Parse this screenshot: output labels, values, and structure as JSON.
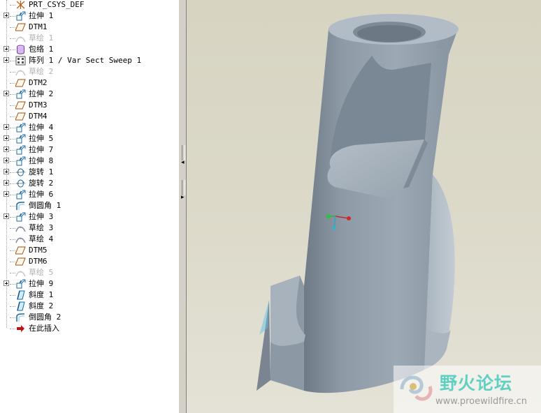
{
  "model_tree": {
    "items": [
      {
        "label": "PRT_CSYS_DEF",
        "icon": "csys-icon",
        "expandable": false,
        "suppressed": false
      },
      {
        "label": "拉伸 1",
        "icon": "extrude-icon",
        "expandable": true,
        "suppressed": false
      },
      {
        "label": "DTM1",
        "icon": "datum-plane-icon",
        "expandable": false,
        "suppressed": false
      },
      {
        "label": "草绘 1",
        "icon": "sketch-icon",
        "expandable": false,
        "suppressed": true
      },
      {
        "label": "包络 1",
        "icon": "wrap-icon",
        "expandable": true,
        "suppressed": false
      },
      {
        "label": "阵列 1 / Var Sect Sweep 1",
        "icon": "pattern-icon",
        "expandable": true,
        "suppressed": false
      },
      {
        "label": "草绘 2",
        "icon": "sketch-icon",
        "expandable": false,
        "suppressed": true
      },
      {
        "label": "DTM2",
        "icon": "datum-plane-icon",
        "expandable": false,
        "suppressed": false
      },
      {
        "label": "拉伸 2",
        "icon": "extrude-icon",
        "expandable": true,
        "suppressed": false
      },
      {
        "label": "DTM3",
        "icon": "datum-plane-icon",
        "expandable": false,
        "suppressed": false
      },
      {
        "label": "DTM4",
        "icon": "datum-plane-icon",
        "expandable": false,
        "suppressed": false
      },
      {
        "label": "拉伸 4",
        "icon": "extrude-icon",
        "expandable": true,
        "suppressed": false
      },
      {
        "label": "拉伸 5",
        "icon": "extrude-icon",
        "expandable": true,
        "suppressed": false
      },
      {
        "label": "拉伸 7",
        "icon": "extrude-icon",
        "expandable": true,
        "suppressed": false
      },
      {
        "label": "拉伸 8",
        "icon": "extrude-icon",
        "expandable": true,
        "suppressed": false
      },
      {
        "label": "旋转 1",
        "icon": "revolve-icon",
        "expandable": true,
        "suppressed": false
      },
      {
        "label": "旋转 2",
        "icon": "revolve-icon",
        "expandable": true,
        "suppressed": false
      },
      {
        "label": "拉伸 6",
        "icon": "extrude-icon",
        "expandable": true,
        "suppressed": false
      },
      {
        "label": "倒圆角 1",
        "icon": "round-icon",
        "expandable": false,
        "suppressed": false
      },
      {
        "label": "拉伸 3",
        "icon": "extrude-icon",
        "expandable": true,
        "suppressed": false
      },
      {
        "label": "草绘 3",
        "icon": "sketch-icon",
        "expandable": false,
        "suppressed": false
      },
      {
        "label": "草绘 4",
        "icon": "sketch-icon",
        "expandable": false,
        "suppressed": false
      },
      {
        "label": "DTM5",
        "icon": "datum-plane-icon",
        "expandable": false,
        "suppressed": false
      },
      {
        "label": "DTM6",
        "icon": "datum-plane-icon",
        "expandable": false,
        "suppressed": false
      },
      {
        "label": "草绘 5",
        "icon": "sketch-icon",
        "expandable": false,
        "suppressed": true
      },
      {
        "label": "拉伸 9",
        "icon": "extrude-icon",
        "expandable": true,
        "suppressed": false
      },
      {
        "label": "斜度 1",
        "icon": "draft-icon",
        "expandable": false,
        "suppressed": false
      },
      {
        "label": "斜度 2",
        "icon": "draft-icon",
        "expandable": false,
        "suppressed": false
      },
      {
        "label": "倒圆角 2",
        "icon": "round-icon",
        "expandable": false,
        "suppressed": false
      },
      {
        "label": "在此插入",
        "icon": "insert-here-arrow-icon",
        "expandable": false,
        "suppressed": false
      }
    ]
  },
  "splitter": {
    "collapse_arrow": "◂",
    "expand_arrow": "▸"
  },
  "watermark": {
    "title": "野火论坛",
    "url": "www.proewildfire.cn"
  },
  "colors": {
    "model_gray": "#9aa6b1",
    "background_top": "#d7d4c2",
    "background_bottom": "#e4e2d6",
    "watermark_accent": "#5fd0c2"
  }
}
